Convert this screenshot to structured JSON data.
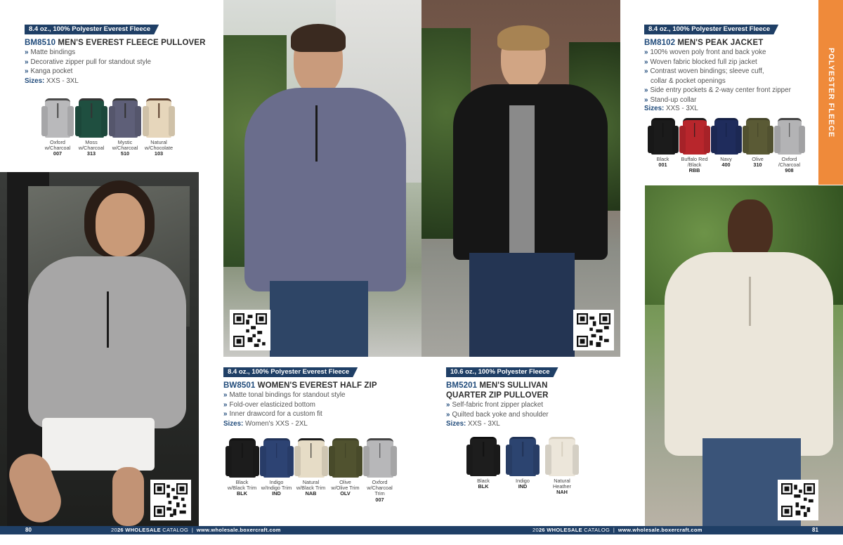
{
  "colors": {
    "navy": "#1f3f66",
    "accent": "#ef8a3a",
    "arrow": "#1f4a7a"
  },
  "footer": {
    "left_page": "80",
    "right_page": "81",
    "year_prefix": "20",
    "year_bold": "26 WHOLESALE",
    "catalog": " CATALOG  |  ",
    "url": "www.wholesale.boxercraft.com"
  },
  "side_tab": "POLYESTER FLEECE",
  "products": {
    "bm8510": {
      "tag": "8.4 oz., 100% Polyester Everest Fleece",
      "code": "BM8510",
      "name": " MEN'S EVEREST FLEECE PULLOVER",
      "features": [
        "Matte bindings",
        "Decorative zipper pull for standout style",
        "Kanga pocket"
      ],
      "sizes_label": "Sizes:",
      "sizes": " XXS - 3XL",
      "colors": [
        {
          "name1": "Oxford",
          "name2": "w/Charcoal",
          "code": "007",
          "fill": "#b9b9bb",
          "trim": "#4a4a4a"
        },
        {
          "name1": "Moss",
          "name2": "w/Charcoal",
          "code": "313",
          "fill": "#1f4f40",
          "trim": "#333333"
        },
        {
          "name1": "Mystic",
          "name2": "w/Charcoal",
          "code": "510",
          "fill": "#5e5f78",
          "trim": "#333333"
        },
        {
          "name1": "Natural",
          "name2": "w/Chocolate",
          "code": "103",
          "fill": "#e6d6bb",
          "trim": "#5a3e2c"
        }
      ]
    },
    "bm8102": {
      "tag": "8.4 oz., 100% Polyester Everest Fleece",
      "code": "BM8102",
      "name": " MEN'S PEAK JACKET",
      "features": [
        "100% woven poly front and back yoke",
        "Woven fabric blocked full zip jacket",
        "Contrast woven bindings; sleeve cuff,",
        "collar & pocket openings",
        "Side entry pockets & 2-way center front zipper",
        "Stand-up collar"
      ],
      "sizes_label": "Sizes:",
      "sizes": " XXS - 3XL",
      "colors": [
        {
          "name1": "Black",
          "name2": "",
          "code": "001",
          "fill": "#1b1b1b",
          "trim": "#111111"
        },
        {
          "name1": "Buffalo Red",
          "name2": "/Black",
          "code": "RBB",
          "fill": "#b8262c",
          "trim": "#1a1a1a"
        },
        {
          "name1": "Navy",
          "name2": "",
          "code": "400",
          "fill": "#1f2c5c",
          "trim": "#152044"
        },
        {
          "name1": "Olive",
          "name2": "",
          "code": "310",
          "fill": "#5a5a35",
          "trim": "#45452a"
        },
        {
          "name1": "Oxford",
          "name2": "/Charcoal",
          "code": "908",
          "fill": "#b3b3b5",
          "trim": "#444444"
        }
      ]
    },
    "bw8501": {
      "tag": "8.4 oz., 100% Polyester Everest Fleece",
      "code": "BW8501",
      "name": " WOMEN'S EVEREST HALF ZIP",
      "features": [
        "Matte tonal bindings for standout style",
        "Fold-over elasticized bottom",
        "Inner drawcord for a custom fit"
      ],
      "sizes_label": "Sizes:",
      "sizes": " Women's XXS - 2XL",
      "colors": [
        {
          "name1": "Black",
          "name2": "w/Black Trim",
          "code": "BLK",
          "fill": "#1c1c1c",
          "trim": "#0f0f0f"
        },
        {
          "name1": "Indigo",
          "name2": "w/Indigo Trim",
          "code": "IND",
          "fill": "#2d4373",
          "trim": "#203157"
        },
        {
          "name1": "Natural",
          "name2": "w/Black Trim",
          "code": "NAB",
          "fill": "#e6dcc6",
          "trim": "#1a1a1a"
        },
        {
          "name1": "Olive",
          "name2": "w/Olive Trim",
          "code": "OLV",
          "fill": "#50522f",
          "trim": "#3f4126"
        },
        {
          "name1": "Oxford",
          "name2": "w/Charcoal Trim",
          "code": "007",
          "fill": "#b7b7b9",
          "trim": "#444444"
        }
      ]
    },
    "bm5201": {
      "tag": "10.6 oz., 100% Polyester Fleece",
      "code": "BM5201",
      "name1": " MEN'S SULLIVAN",
      "name2": "QUARTER ZIP PULLOVER",
      "features": [
        "Self-fabric front zipper placket",
        "Quilted back yoke and shoulder"
      ],
      "sizes_label": "Sizes:",
      "sizes": " XXS - 3XL",
      "colors": [
        {
          "name1": "Black",
          "name2": "",
          "code": "BLK",
          "fill": "#1d1d1d",
          "trim": "#111111"
        },
        {
          "name1": "Indigo",
          "name2": "",
          "code": "IND",
          "fill": "#2c4470",
          "trim": "#203256"
        },
        {
          "name1": "Natural",
          "name2": "Heather",
          "code": "NAH",
          "fill": "#ece6da",
          "trim": "#d8d0c0"
        }
      ]
    }
  }
}
